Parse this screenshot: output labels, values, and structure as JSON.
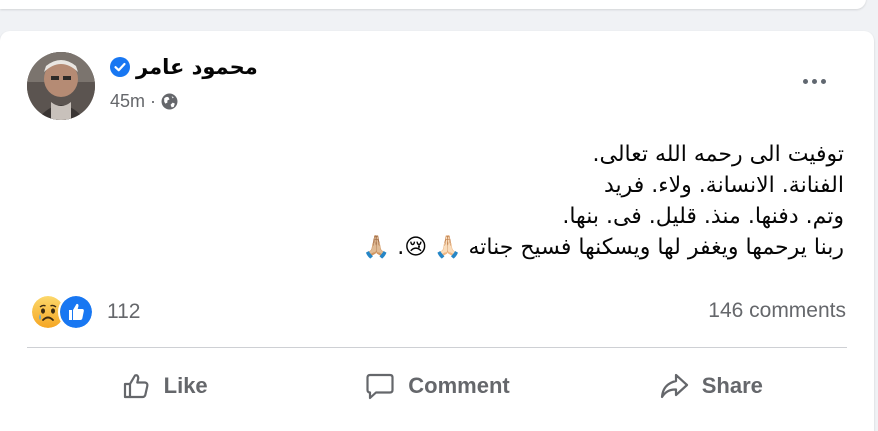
{
  "post": {
    "author": "محمود عامر",
    "time": "45m",
    "separator": "·",
    "lines": [
      "توفيت الى رحمه الله تعالى.",
      "الفنانة. الانسانة.  ولاء. فريد",
      "وتم. دفنها. منذ. قليل. فى. بنها.",
      "ربنا يرحمها ويغفر لها ويسكنها فسيح جناته 🙏🏻 😢. 🙏🏼"
    ]
  },
  "reactions": {
    "icons": [
      "sad-reaction-icon",
      "like-reaction-icon"
    ],
    "count": "112"
  },
  "comments": {
    "label": "146 comments"
  },
  "actions": {
    "like": "Like",
    "comment": "Comment",
    "share": "Share"
  },
  "colors": {
    "verified": "#1877f2",
    "like": "#1877f2",
    "secondary_text": "#65676b"
  }
}
